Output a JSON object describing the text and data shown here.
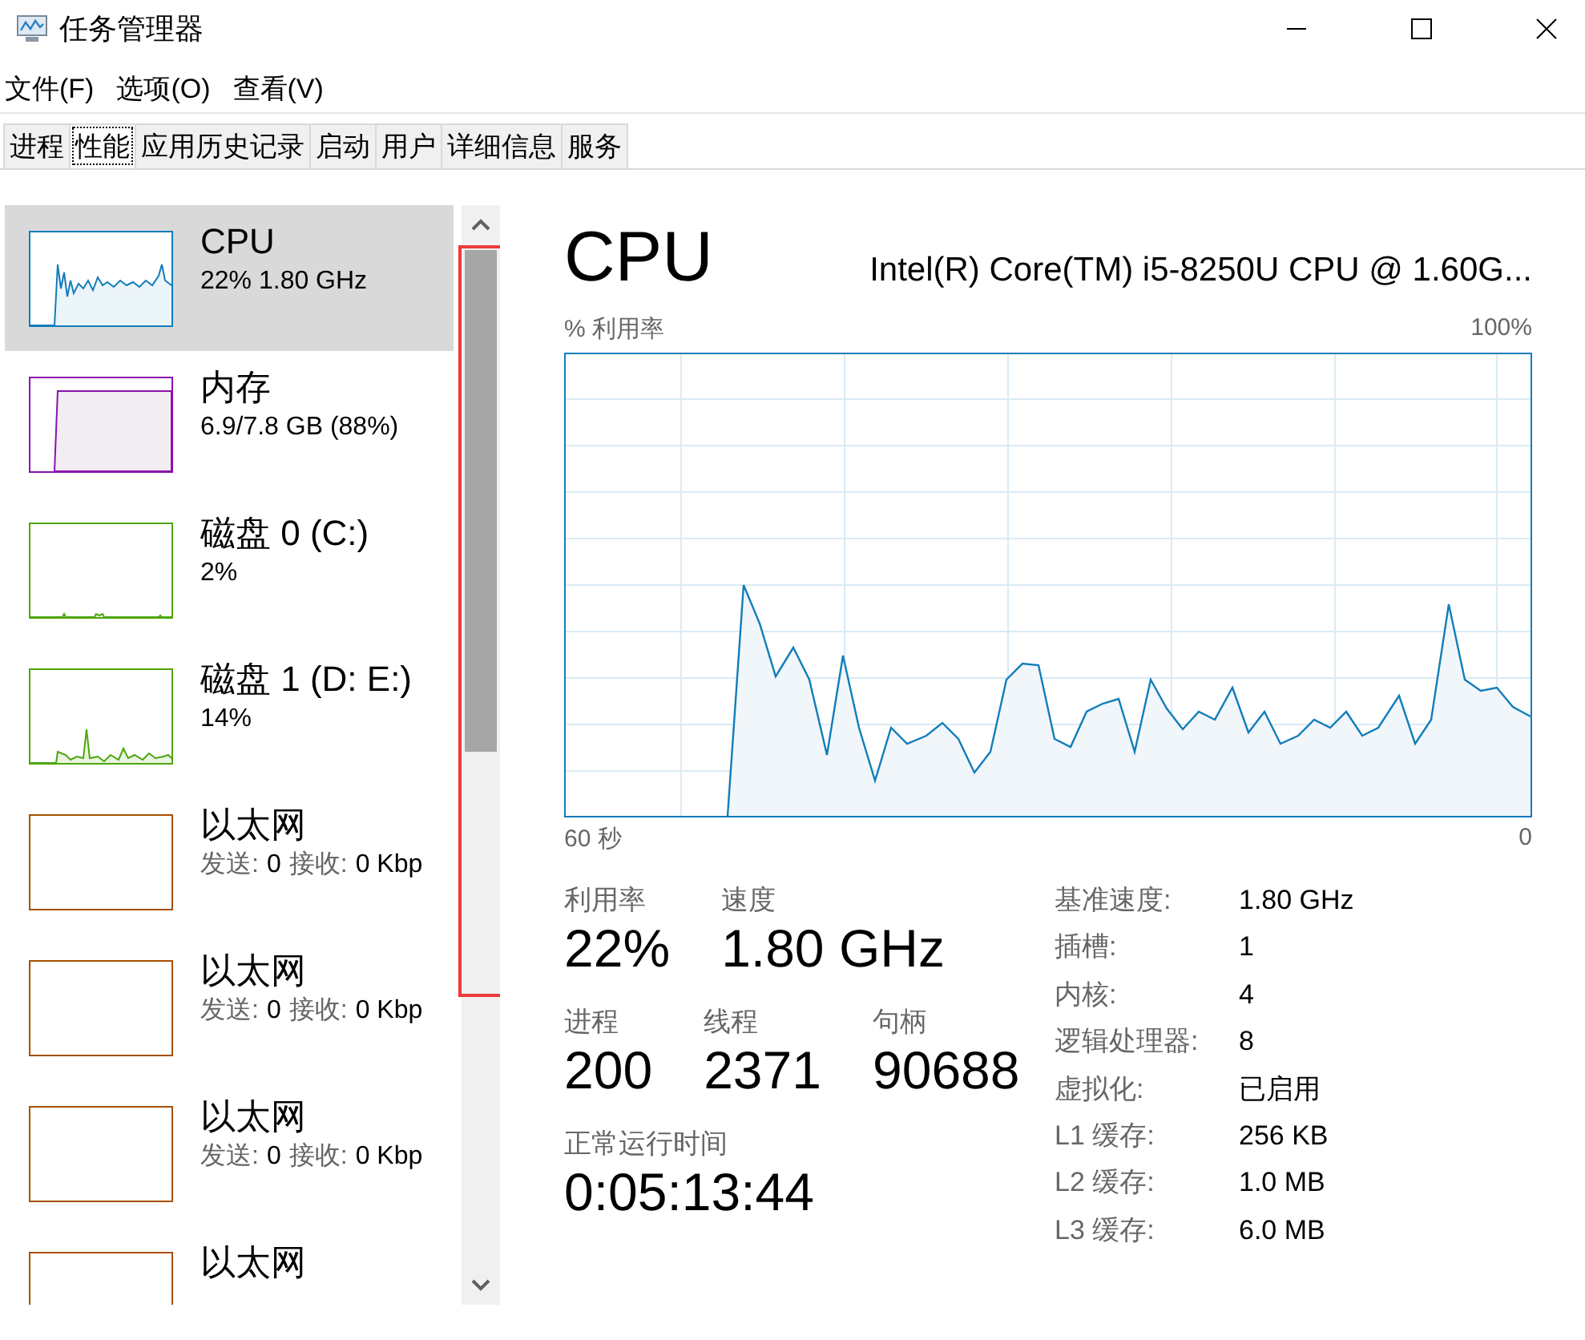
{
  "window": {
    "title": "任务管理器"
  },
  "menu": [
    "文件(F)",
    "选项(O)",
    "查看(V)"
  ],
  "tabs": [
    {
      "label": "进程",
      "selected": false
    },
    {
      "label": "性能",
      "selected": true
    },
    {
      "label": "应用历史记录",
      "selected": false
    },
    {
      "label": "启动",
      "selected": false
    },
    {
      "label": "用户",
      "selected": false
    },
    {
      "label": "详细信息",
      "selected": false
    },
    {
      "label": "服务",
      "selected": false
    }
  ],
  "sidebar": {
    "items": [
      {
        "kind": "cpu",
        "title": "CPU",
        "detail": "22% 1.80 GHz",
        "color": "#117dbb",
        "selected": true
      },
      {
        "kind": "memory",
        "title": "内存",
        "detail": "6.9/7.8 GB (88%)",
        "color": "#8b12ae",
        "selected": false
      },
      {
        "kind": "disk",
        "title": "磁盘 0 (C:)",
        "detail": "2%",
        "color": "#4da60c",
        "selected": false
      },
      {
        "kind": "disk-busy",
        "title": "磁盘 1 (D: E:)",
        "detail": "14%",
        "color": "#4da60c",
        "selected": false
      },
      {
        "kind": "network",
        "title": "以太网",
        "detail_parts": [
          {
            "kind": "label",
            "text": "发送:"
          },
          {
            "kind": "value",
            "text": "0"
          },
          {
            "kind": "label",
            "text": "接收:"
          },
          {
            "kind": "value",
            "text": "0 Kbp"
          }
        ],
        "color": "#a74f01",
        "selected": false
      },
      {
        "kind": "network",
        "title": "以太网",
        "detail_parts": [
          {
            "kind": "label",
            "text": "发送:"
          },
          {
            "kind": "value",
            "text": "0"
          },
          {
            "kind": "label",
            "text": "接收:"
          },
          {
            "kind": "value",
            "text": "0 Kbp"
          }
        ],
        "color": "#a74f01",
        "selected": false
      },
      {
        "kind": "network",
        "title": "以太网",
        "detail_parts": [
          {
            "kind": "label",
            "text": "发送:"
          },
          {
            "kind": "value",
            "text": "0"
          },
          {
            "kind": "label",
            "text": "接收:"
          },
          {
            "kind": "value",
            "text": "0 Kbp"
          }
        ],
        "color": "#a74f01",
        "selected": false
      },
      {
        "kind": "network",
        "title": "以太网",
        "color": "#a74f01",
        "selected": false
      }
    ],
    "scrollbar": {
      "highlighted": true
    }
  },
  "main": {
    "title": "CPU",
    "subtitle": "Intel(R) Core(TM) i5-8250U CPU @ 1.60G...",
    "graph": {
      "y_label": "% 利用率",
      "y_max": "100%",
      "x_start": "60 秒",
      "x_end": "0"
    },
    "stat_rows": [
      [
        {
          "label": "利用率",
          "value": "22%"
        },
        {
          "label": "速度",
          "value": "1.80 GHz"
        }
      ],
      [
        {
          "label": "进程",
          "value": "200"
        },
        {
          "label": "线程",
          "value": "2371"
        },
        {
          "label": "句柄",
          "value": "90688"
        }
      ],
      [
        {
          "label": "正常运行时间",
          "value": "0:05:13:44"
        }
      ]
    ],
    "details": [
      {
        "label": "基准速度:",
        "value": "1.80 GHz"
      },
      {
        "label": "插槽:",
        "value": "1"
      },
      {
        "label": "内核:",
        "value": "4"
      },
      {
        "label": "逻辑处理器:",
        "value": "8"
      },
      {
        "label": "虚拟化:",
        "value": "已启用"
      },
      {
        "label": "L1 缓存:",
        "value": "256 KB"
      },
      {
        "label": "L2 缓存:",
        "value": "1.0 MB"
      },
      {
        "label": "L3 缓存:",
        "value": "6.0 MB"
      }
    ]
  }
}
